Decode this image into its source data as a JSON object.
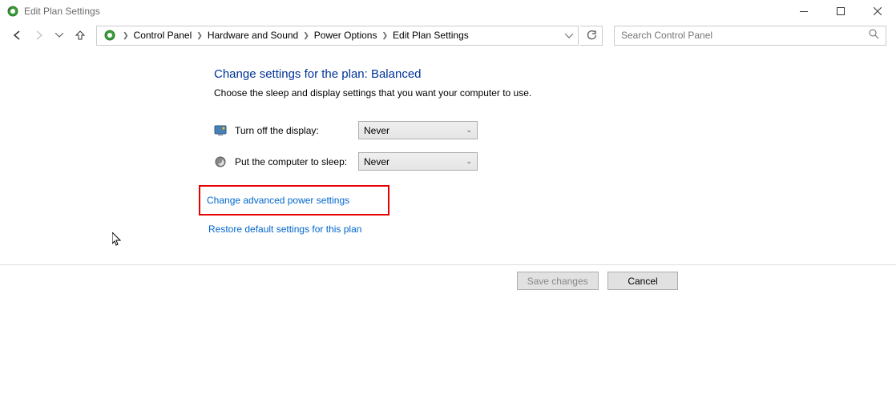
{
  "titlebar": {
    "text": "Edit Plan Settings"
  },
  "breadcrumb": {
    "items": [
      "Control Panel",
      "Hardware and Sound",
      "Power Options",
      "Edit Plan Settings"
    ]
  },
  "search": {
    "placeholder": "Search Control Panel"
  },
  "content": {
    "heading": "Change settings for the plan: Balanced",
    "subtext": "Choose the sleep and display settings that you want your computer to use.",
    "settings": [
      {
        "label": "Turn off the display:",
        "value": "Never"
      },
      {
        "label": "Put the computer to sleep:",
        "value": "Never"
      }
    ],
    "links": {
      "advanced": "Change advanced power settings",
      "restore": "Restore default settings for this plan"
    }
  },
  "buttons": {
    "save": "Save changes",
    "cancel": "Cancel"
  }
}
